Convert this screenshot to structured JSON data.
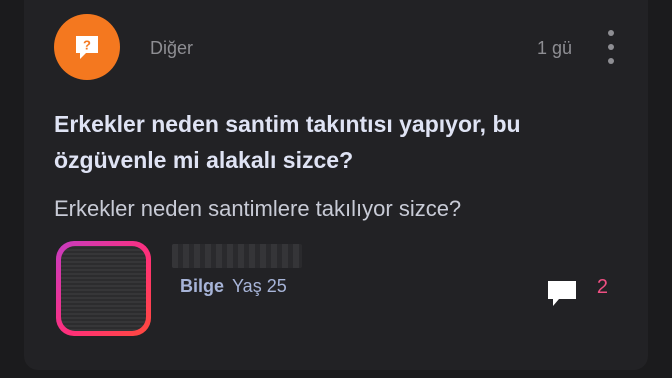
{
  "post": {
    "category": "Diğer",
    "category_icon": "question-bubble-icon",
    "category_color": "#f4781f",
    "time_ago": "1 gü",
    "title": "Erkekler neden santim takıntısı yapıyor, bu\nözgüvenle mi alakalı sizce?",
    "body": "Erkekler neden santimlere takılıyor sizce?",
    "comment_count": "2"
  },
  "author": {
    "level": "Bilge",
    "age": "Yaş 25"
  },
  "colors": {
    "background": "#222225",
    "title": "#dfe3f4",
    "accent_pink": "#ef4f82"
  }
}
